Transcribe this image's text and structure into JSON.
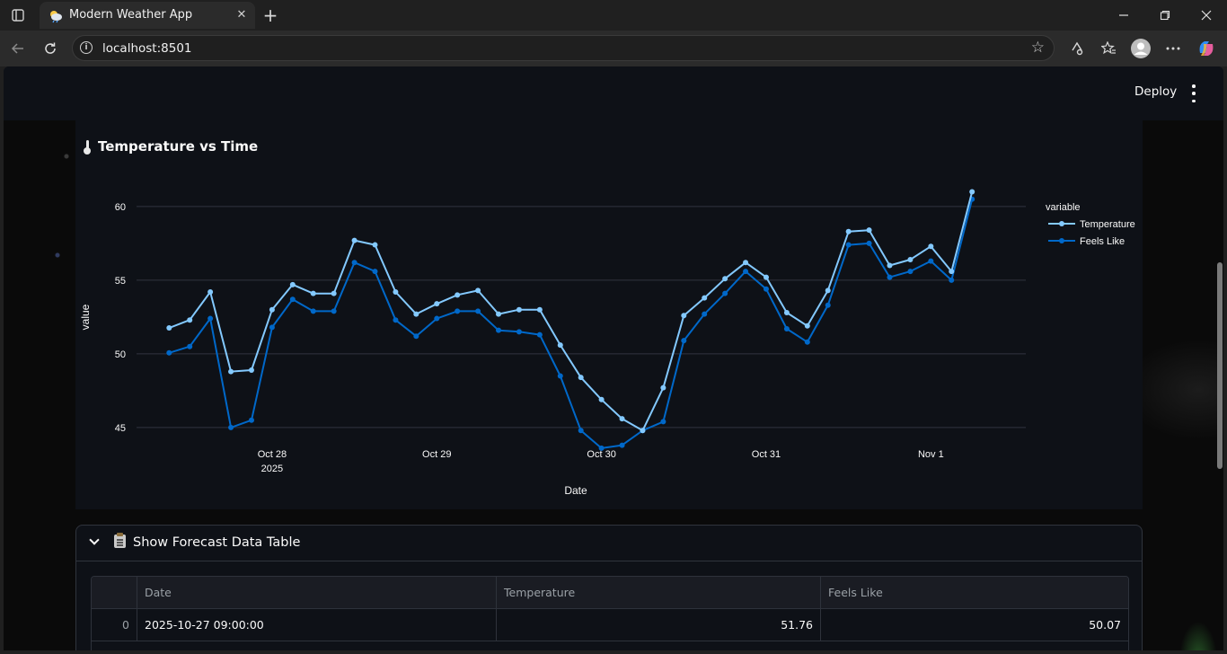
{
  "browser": {
    "tab_title": "Modern Weather App",
    "url": "localhost:8501"
  },
  "app": {
    "deploy_label": "Deploy"
  },
  "chart_section": {
    "title": "Temperature vs Time"
  },
  "chart_data": {
    "type": "line",
    "xlabel": "Date",
    "ylabel": "value",
    "legend_title": "variable",
    "legend_position": "top-right",
    "ylim": [
      42.8,
      62.8
    ],
    "yticks": [
      45,
      50,
      55,
      60
    ],
    "grid": true,
    "start": "2025-10-27T09:00:00",
    "step_hours": 3,
    "xticks": [
      {
        "label": "Oct 28",
        "sublabel": "2025",
        "at": "2025-10-28T00:00:00"
      },
      {
        "label": "Oct 29",
        "sublabel": "",
        "at": "2025-10-29T00:00:00"
      },
      {
        "label": "Oct 30",
        "sublabel": "",
        "at": "2025-10-30T00:00:00"
      },
      {
        "label": "Oct 31",
        "sublabel": "",
        "at": "2025-10-31T00:00:00"
      },
      {
        "label": "Nov 1",
        "sublabel": "",
        "at": "2025-11-01T00:00:00"
      }
    ],
    "series": [
      {
        "name": "Temperature",
        "color": "#83c9ff",
        "values": [
          51.76,
          52.3,
          54.2,
          48.8,
          48.9,
          53.0,
          54.7,
          54.1,
          54.1,
          57.7,
          57.4,
          54.2,
          52.7,
          53.4,
          54.0,
          54.3,
          52.7,
          53.0,
          53.0,
          50.6,
          48.4,
          46.9,
          45.6,
          44.8,
          47.7,
          52.6,
          53.8,
          55.1,
          56.2,
          55.2,
          52.8,
          51.9,
          54.3,
          58.3,
          58.4,
          56.0,
          56.4,
          57.3,
          55.6,
          61.0
        ]
      },
      {
        "name": "Feels Like",
        "color": "#0068c9",
        "values": [
          50.07,
          50.5,
          52.4,
          45.0,
          45.5,
          51.8,
          53.7,
          52.9,
          52.9,
          56.2,
          55.6,
          52.3,
          51.2,
          52.4,
          52.9,
          52.9,
          51.6,
          51.5,
          51.3,
          48.5,
          44.8,
          43.6,
          43.8,
          44.8,
          45.4,
          50.9,
          52.7,
          54.1,
          55.6,
          54.4,
          51.7,
          50.8,
          53.3,
          57.4,
          57.5,
          55.2,
          55.6,
          56.3,
          55.0,
          60.5
        ]
      }
    ]
  },
  "expander": {
    "label": "Show Forecast Data Table",
    "table": {
      "columns": [
        "",
        "Date",
        "Temperature",
        "Feels Like"
      ],
      "rows": [
        {
          "index": "0",
          "date": "2025-10-27 09:00:00",
          "temperature": "51.76",
          "feels_like": "50.07"
        }
      ]
    }
  }
}
